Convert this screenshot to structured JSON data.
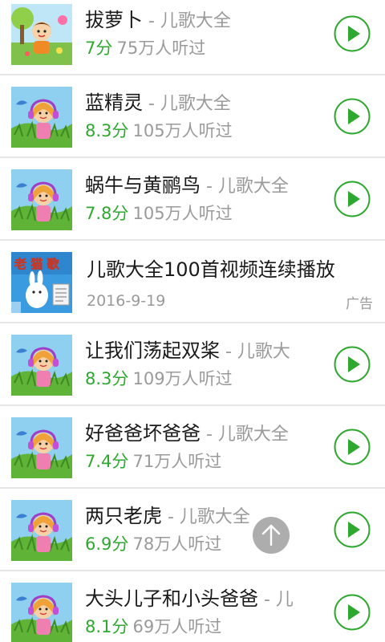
{
  "songs": [
    {
      "title": "拔萝卜",
      "artist": " - 儿歌大全",
      "score": "7分",
      "listens": "75万人听过",
      "thumb": "kid-illustration"
    },
    {
      "title": "蓝精灵",
      "artist": " - 儿歌大全",
      "score": "8.3分",
      "listens": "105万人听过",
      "thumb": "girl-headphones"
    },
    {
      "title": "蜗牛与黄鹂鸟",
      "artist": " - 儿歌大全",
      "score": "7.8分",
      "listens": "105万人听过",
      "thumb": "girl-headphones"
    },
    {
      "title": "让我们荡起双桨",
      "artist": " - 儿歌大",
      "score": "8.3分",
      "listens": "109万人听过",
      "thumb": "girl-headphones"
    },
    {
      "title": "好爸爸坏爸爸",
      "artist": " - 儿歌大全",
      "score": "7.4分",
      "listens": "71万人听过",
      "thumb": "girl-headphones"
    },
    {
      "title": "两只老虎",
      "artist": " - 儿歌大全",
      "score": "6.9分",
      "listens": "78万人听过",
      "thumb": "girl-headphones"
    },
    {
      "title": "大头儿子和小头爸爸",
      "artist": " - 儿",
      "score": "8.1分",
      "listens": "69万人听过",
      "thumb": "girl-headphones"
    }
  ],
  "ad": {
    "title": "儿歌大全100首视频连续播放",
    "date": "2016-9-19",
    "tag": "广告",
    "thumb_text": "老 猫 歌"
  },
  "icons": {
    "play": "play-circle-icon",
    "scroll_top": "arrow-up-icon"
  },
  "colors": {
    "accent_green": "#2fa82f",
    "gray_text": "#9a9a9a",
    "divider": "#e6e6e6"
  }
}
